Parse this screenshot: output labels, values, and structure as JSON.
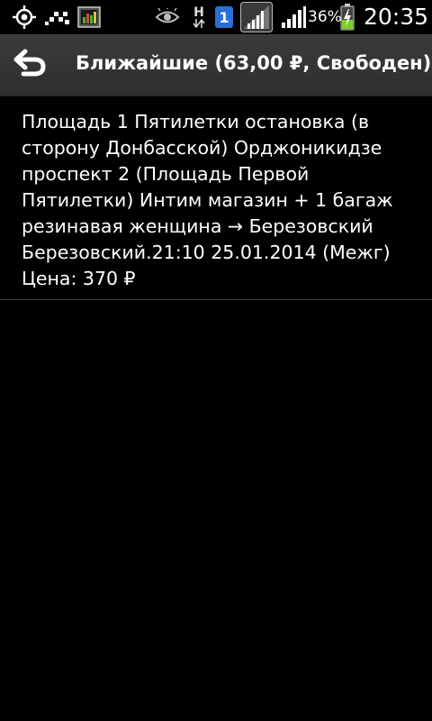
{
  "status_bar": {
    "icons": [
      "gps-icon",
      "taxi-checker-icon",
      "app-chart-icon",
      "eye-icon",
      "network-h-icon",
      "notification-badge-icon",
      "wifi-signal-icon",
      "cell-signal-icon",
      "battery-charging-icon"
    ],
    "network_type": "H",
    "notification_count": "1",
    "battery_percent": "36%",
    "time": "20:35"
  },
  "action_bar": {
    "title": "Ближайшие (63,00 ₽, Свободен)"
  },
  "list": {
    "items": [
      {
        "description": "Площадь 1 Пятилетки остановка (в сторону Донбасской) Орджоникидзе проспект 2 (Площадь Первой Пятилетки) Интим магазин + 1 багаж резинавая женщина → Березовский Березовский.21:10 25.01.2014 (Межг)",
        "price": "Цена: 370 ₽"
      }
    ]
  },
  "colors": {
    "background": "#000000",
    "action_bar": "#333333",
    "text": "#ffffff",
    "battery_green": "#7ccf2a",
    "notification_blue": "#2a6fd6"
  }
}
